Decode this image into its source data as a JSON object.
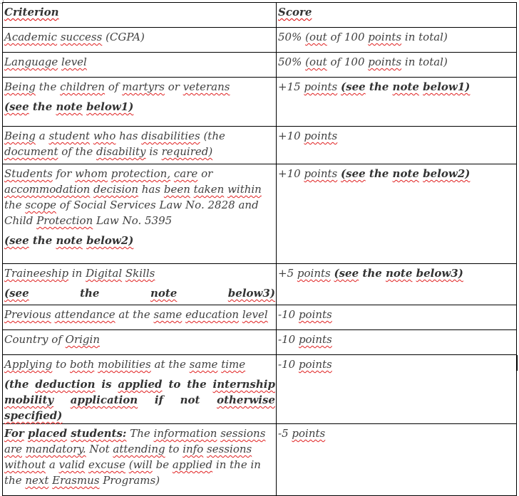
{
  "table": {
    "headers": {
      "criterion": "Criterion",
      "score": "Score"
    },
    "rows": [
      {
        "criterion": "Academic success (CGPA)",
        "score": "50% (out of 100 points in total)"
      },
      {
        "criterion": "Language level",
        "score": "50% (out of 100 points in total)"
      },
      {
        "criterion": "Being the children of martyrs or veterans",
        "criterion_note": "(see the note below1)",
        "score": "+15 points",
        "score_note": "(see the note below1)"
      },
      {
        "criterion": "Being a student who has disabilities (the document of the disability is required)",
        "score": "+10 points"
      },
      {
        "criterion": "Students for whom protection, care or accommodation decision has been taken within the scope of Social Services Law No. 2828 and Child Protection Law No. 5395",
        "criterion_note": "(see the note below2)",
        "score": "+10 points",
        "score_note": "(see the note below2)"
      },
      {
        "criterion": "Traineeship in Digital Skills",
        "criterion_note": "(see the note below3)",
        "score": "+5 points",
        "score_note": "(see the note below3)"
      },
      {
        "criterion": "Previous attendance at the same education level",
        "score": "-10 points"
      },
      {
        "criterion": "Country of Origin",
        "score": "-10 points"
      },
      {
        "criterion": "Applying to both mobilities at the same time",
        "criterion_note": "(the deduction is applied to the internship mobility application if not otherwise specified)",
        "score": "-10 points"
      },
      {
        "criterion_lead": "For placed students:",
        "criterion": "The information sessions are mandatory. Not attending to info sessions without a valid excuse (will be applied in the in the next Erasmus Programs)",
        "score": "-5 points"
      }
    ]
  }
}
